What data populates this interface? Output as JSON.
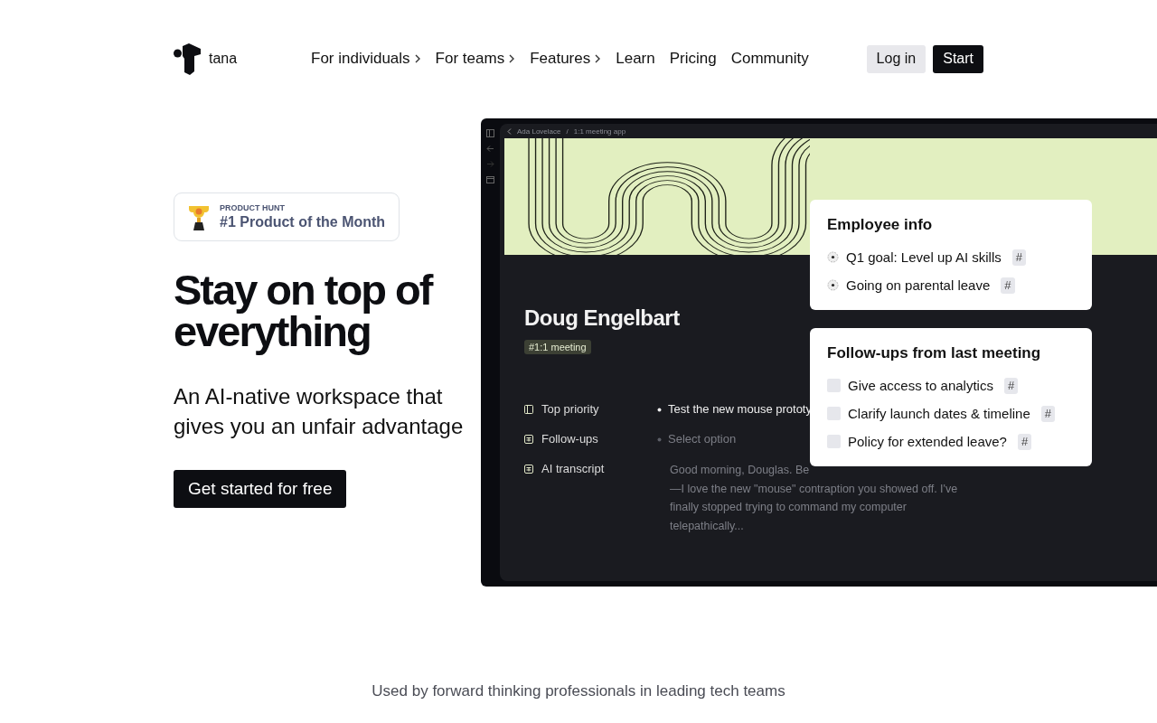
{
  "header": {
    "logo_text": "tana",
    "nav": [
      {
        "label": "For individuals",
        "has_menu": true
      },
      {
        "label": "For teams",
        "has_menu": true
      },
      {
        "label": "Features",
        "has_menu": true
      },
      {
        "label": "Learn",
        "has_menu": false
      },
      {
        "label": "Pricing",
        "has_menu": false
      },
      {
        "label": "Community",
        "has_menu": false
      }
    ],
    "buttons": [
      {
        "label": "Log in",
        "kind": "secondary"
      },
      {
        "label": "Start",
        "kind": "primary"
      }
    ]
  },
  "hero": {
    "badge": {
      "overline": "PRODUCT HUNT",
      "title": "#1 Product of the Month"
    },
    "headline": "Stay on top of everything",
    "subheadline": "An AI-native workspace that gives you an unfair advantage",
    "cta": "Get started for free"
  },
  "app": {
    "breadcrumb": [
      "Ada Lovelace",
      "1:1 meeting app"
    ],
    "separator": "/",
    "page_title": "Doug Engelbart",
    "tag": "#1:1 meeting",
    "fields": [
      {
        "label": "Top priority",
        "kind": "bullet",
        "value": "Test the new mouse prototy"
      },
      {
        "label": "Follow-ups",
        "kind": "placeholder",
        "value": "Select option"
      },
      {
        "label": "AI transcript",
        "kind": "text",
        "lines": [
          "Good morning, Douglas. Be",
          "—I love the new \"mouse\" contraption you showed off. I've",
          "finally stopped trying to command my computer",
          "telepathically..."
        ]
      }
    ],
    "cards": [
      {
        "title": "Employee info",
        "kind": "radio",
        "items": [
          {
            "text": "Q1 goal: Level up AI skills",
            "tag": "#"
          },
          {
            "text": "Going on parental leave",
            "tag": "#"
          }
        ]
      },
      {
        "title": "Follow-ups from last meeting",
        "kind": "checkbox",
        "items": [
          {
            "text": "Give access to analytics",
            "tag": "#",
            "checked": false
          },
          {
            "text": "Clarify launch dates & timeline",
            "tag": "#",
            "checked": false
          },
          {
            "text": "Policy for extended leave?",
            "tag": "#",
            "checked": false
          }
        ]
      }
    ]
  },
  "footer_text": "Used by forward thinking professionals in leading tech teams"
}
